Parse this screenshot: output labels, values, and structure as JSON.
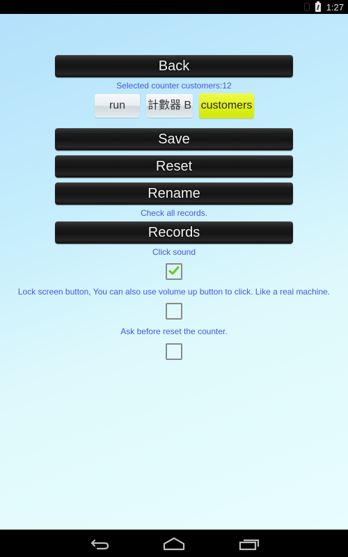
{
  "status_bar": {
    "time": "1:27",
    "icons": [
      "bluetooth-icon",
      "battery-icon"
    ]
  },
  "buttons": {
    "back": "Back",
    "save": "Save",
    "reset": "Reset",
    "rename": "Rename",
    "records": "Records"
  },
  "selected_counter_text": "Selected counter customers:12",
  "counters": [
    {
      "label": "run",
      "selected": false
    },
    {
      "label": "計數器 B",
      "selected": false
    },
    {
      "label": "customers",
      "selected": true
    }
  ],
  "captions": {
    "check_records": "Check all records.",
    "click_sound": "Click sound",
    "lock_screen": "Lock screen button, You can also use volume up button to click. Like a real machine.",
    "ask_reset": "Ask before reset the counter."
  },
  "settings": {
    "click_sound_checked": true,
    "lock_screen_checked": false,
    "ask_reset_checked": false
  },
  "colors": {
    "caption_blue": "#4557e0",
    "selected_counter": "#dff21c",
    "check_green": "#6cc51c"
  },
  "nav_bar": {
    "icons": [
      "back-icon",
      "home-icon",
      "recent-apps-icon"
    ]
  }
}
